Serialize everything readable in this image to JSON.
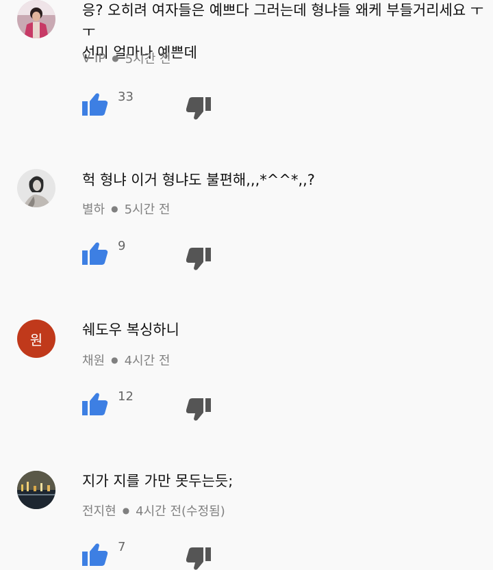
{
  "comments": [
    {
      "text": "응? 오히려 여자들은 예쁘다 그러는데 형냐들 왜케 부들거리세요 ㅜㅜ\n선미 얼마나 예쁜데",
      "author": "V IP",
      "time": "5시간 전",
      "likes": "33",
      "avatar": "photo"
    },
    {
      "text": "헉 형냐 이거 형냐도 불편해,,,*^^*,,?",
      "author": "별하",
      "time": "5시간 전",
      "likes": "9",
      "avatar": "photo"
    },
    {
      "text": "쉐도우 복싱하니",
      "author": "채원",
      "time": "4시간 전",
      "likes": "12",
      "avatar_letter": "원",
      "avatar_color": "#c0391b"
    },
    {
      "text": "지가 지를 가만 못두는듯;",
      "author": "전지현",
      "time": "4시간 전(수정됨)",
      "likes": "7",
      "avatar": "photo"
    }
  ],
  "icons": {
    "like": "thumbs-up-icon",
    "dislike": "thumbs-down-icon"
  },
  "colors": {
    "like": "#3d7fe3",
    "dislike": "#555555",
    "meta": "#808080"
  }
}
